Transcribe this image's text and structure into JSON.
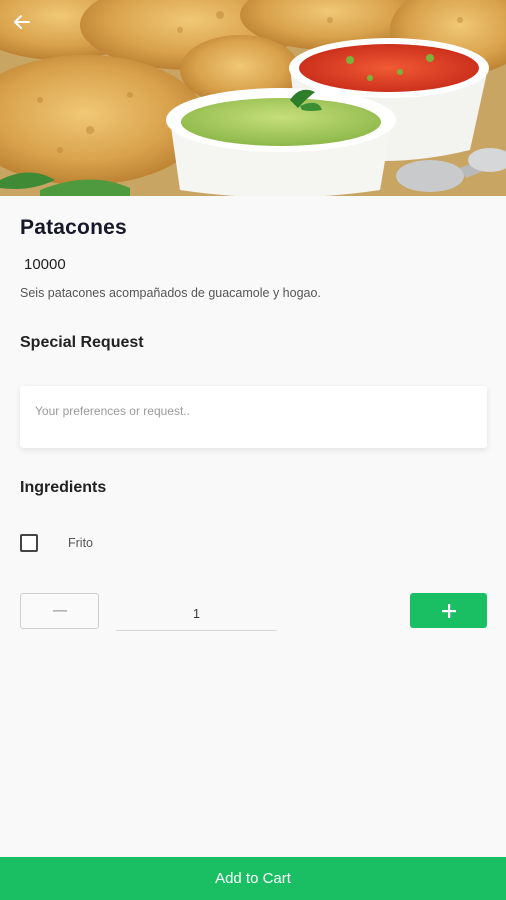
{
  "hero": {
    "image_alt": "patacones-with-guacamole-and-hogao",
    "back_icon": "arrow-left-icon"
  },
  "product": {
    "title": "Patacones",
    "price": "10000",
    "description": "Seis patacones acompañados de guacamole y hogao."
  },
  "special_request": {
    "title": "Special Request",
    "placeholder": "Your preferences or request..",
    "value": ""
  },
  "ingredients": {
    "title": "Ingredients",
    "items": [
      {
        "label": "Frito",
        "checked": false
      }
    ]
  },
  "quantity": {
    "value": "1",
    "minus_icon": "minus-icon",
    "plus_icon": "plus-icon"
  },
  "cart_button": {
    "label": "Add to Cart"
  },
  "colors": {
    "accent": "#1bbf63",
    "title": "#17192b"
  }
}
